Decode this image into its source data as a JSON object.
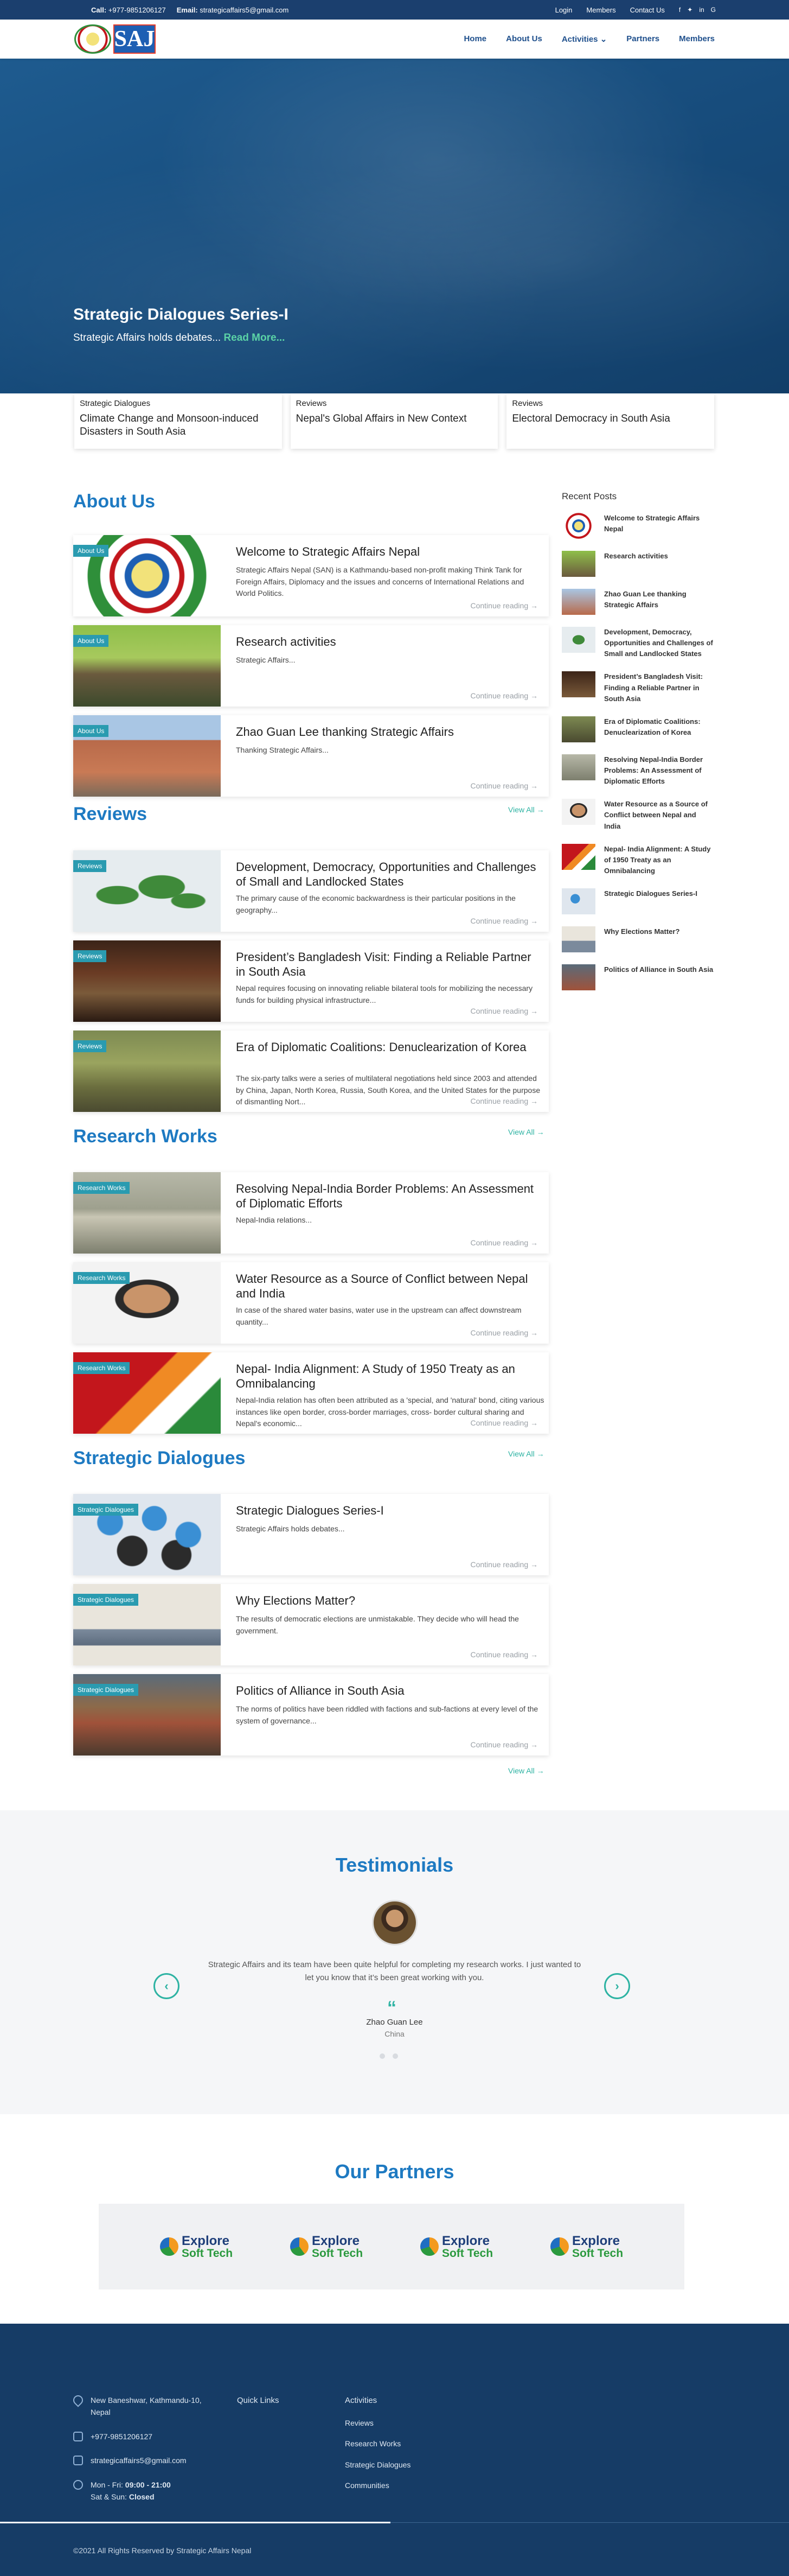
{
  "topbar": {
    "call_label": "Call:",
    "call_value": "+977-9851206127",
    "email_label": "Email:",
    "email_value": "strategicaffairs5@gmail.com",
    "links": [
      "Login",
      "Members",
      "Contact Us"
    ],
    "social": [
      "f",
      "✦",
      "in",
      "G"
    ]
  },
  "brand": {
    "logo_text": "SAJ"
  },
  "nav": [
    "Home",
    "About Us",
    "Activities ⌄",
    "Partners",
    "Members"
  ],
  "hero": {
    "title": "Strategic Dialogues Series-I",
    "text": "Strategic Affairs holds debates...",
    "read_more": "Read More..."
  },
  "strip": [
    {
      "cat": "Strategic Dialogues",
      "title": "Climate Change and Monsoon-induced Disasters in South Asia"
    },
    {
      "cat": "Reviews",
      "title": "Nepal's Global Affairs in New Context"
    },
    {
      "cat": "Reviews",
      "title": "Electoral Democracy in South Asia"
    }
  ],
  "sections": {
    "about": "About Us",
    "reviews": "Reviews",
    "research": "Research Works",
    "dialogues": "Strategic Dialogues"
  },
  "continue": "Continue reading →",
  "view_all": "View All →",
  "posts": {
    "about": [
      {
        "badge": "About Us",
        "title": "Welcome to Strategic Affairs Nepal",
        "excerpt": "Strategic Affairs Nepal (SAN) is a Kathmandu-based non-profit making Think Tank for Foreign Affairs, Diplomacy and the issues and concerns of International Relations and World Politics."
      },
      {
        "badge": "About Us",
        "title": "Research activities",
        "excerpt": "Strategic Affairs..."
      },
      {
        "badge": "About Us",
        "title": "Zhao Guan Lee thanking Strategic Affairs",
        "excerpt": "Thanking Strategic Affairs..."
      }
    ],
    "reviews": [
      {
        "badge": "Reviews",
        "title": "Development, Democracy, Opportunities and Challenges of Small and Landlocked States",
        "excerpt": "The primary cause of the economic backwardness is their particular positions in the geography..."
      },
      {
        "badge": "Reviews",
        "title": "President’s Bangladesh Visit: Finding a Reliable Partner in South Asia",
        "excerpt": "Nepal requires focusing on innovating reliable bilateral tools for mobilizing the necessary funds for building physical infrastructure..."
      },
      {
        "badge": "Reviews",
        "title": "Era of Diplomatic Coalitions: Denuclearization of Korea",
        "excerpt": "The six-party talks were a series of multilateral negotiations held since 2003 and attended by China, Japan, North Korea, Russia, South Korea, and the United States for the purpose of dismantling Nort..."
      }
    ],
    "research": [
      {
        "badge": "Research Works",
        "title": "Resolving Nepal-India Border Problems: An Assessment of Diplomatic Efforts",
        "excerpt": "Nepal-India relations..."
      },
      {
        "badge": "Research Works",
        "title": "Water Resource as a Source of Conflict between Nepal and India",
        "excerpt": "In case of the shared water basins, water use in the upstream can affect downstream quantity..."
      },
      {
        "badge": "Research Works",
        "title": "Nepal- India Alignment: A Study of 1950 Treaty as an Omnibalancing",
        "excerpt": "Nepal-India relation has often been attributed as a 'special, and 'natural' bond, citing various instances like open border, cross-border marriages, cross- border cultural sharing and Nepal's economic..."
      }
    ],
    "dialogues": [
      {
        "badge": "Strategic Dialogues",
        "title": "Strategic Dialogues Series-I",
        "excerpt": "Strategic Affairs holds debates..."
      },
      {
        "badge": "Strategic Dialogues",
        "title": "Why Elections Matter?",
        "excerpt": "The results of democratic elections are unmistakable. They decide who will head the government."
      },
      {
        "badge": "Strategic Dialogues",
        "title": "Politics of Alliance in South Asia",
        "excerpt": "The norms of politics have been riddled with factions and sub-factions at every level of the system of governance..."
      }
    ]
  },
  "sidebar": {
    "title": "Recent Posts",
    "items": [
      "Welcome to Strategic Affairs Nepal",
      "Research activities",
      "Zhao Guan Lee thanking Strategic Affairs",
      "Development, Democracy, Opportunities and Challenges of Small and Landlocked States",
      "President’s Bangladesh Visit: Finding a Reliable Partner in South Asia",
      "Era of Diplomatic Coalitions: Denuclearization of Korea",
      "Resolving Nepal-India Border Problems: An Assessment of Diplomatic Efforts",
      "Water Resource as a Source of Conflict between Nepal and India",
      "Nepal- India Alignment: A Study of 1950 Treaty as an Omnibalancing",
      "Strategic Dialogues Series-I",
      "Why Elections Matter?",
      "Politics of Alliance in South Asia"
    ]
  },
  "testimonials": {
    "title": "Testimonials",
    "quote": "Strategic Affairs and its team have been quite helpful for completing my research works. I just wanted to let you know that it’s been great working with you.",
    "quote_mark": "“",
    "name": "Zhao Guan Lee",
    "location": "China",
    "prev": "‹",
    "next": "›"
  },
  "partners": {
    "title": "Our Partners",
    "logos": [
      {
        "line1": "Explore",
        "line2": "Soft Tech"
      },
      {
        "line1": "Explore",
        "line2": "Soft Tech"
      },
      {
        "line1": "Explore",
        "line2": "Soft Tech"
      },
      {
        "line1": "Explore",
        "line2": "Soft Tech"
      }
    ]
  },
  "footer": {
    "address": "New Baneshwar, Kathmandu-10, Nepal",
    "phone": "+977-9851206127",
    "email": "strategicaffairs5@gmail.com",
    "hours_days": "Mon - Fri:",
    "hours_time": "09:00 - 21:00",
    "weekend_days": "Sat & Sun:",
    "weekend_status": "Closed",
    "quick_links": "Quick Links",
    "activities_title": "Activities",
    "activities": [
      "Reviews",
      "Research Works",
      "Strategic Dialogues",
      "Communities"
    ],
    "copyright": "©2021 All Rights Reserved by Strategic Affairs Nepal"
  }
}
